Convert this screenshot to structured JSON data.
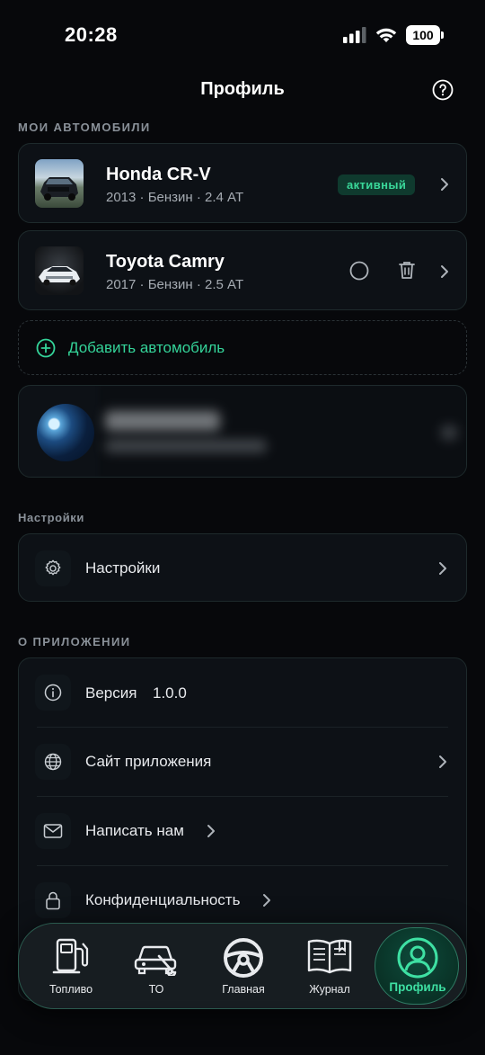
{
  "status_bar": {
    "time": "20:28",
    "battery": "100"
  },
  "header": {
    "title": "Профиль"
  },
  "cars_section": {
    "label": "МОИ АВТОМОБИЛИ",
    "cars": [
      {
        "name": "Honda CR-V",
        "details": "2013 · Бензин · 2.4 AT",
        "badge": "активный"
      },
      {
        "name": "Toyota Camry",
        "details": "2017 · Бензин · 2.5 AT"
      }
    ],
    "add_label": "Добавить автомобиль"
  },
  "settings_section": {
    "label": "Настройки",
    "item_label": "Настройки"
  },
  "about_section": {
    "label": "О ПРИЛОЖЕНИИ",
    "version_label": "Версия",
    "version_value": "1.0.0",
    "website_label": "Сайт приложения",
    "contact_label": "Написать нам",
    "privacy_label": "Конфиденциальность"
  },
  "tabbar": {
    "tabs": [
      {
        "label": "Топливо"
      },
      {
        "label": "ТО"
      },
      {
        "label": "Главная"
      },
      {
        "label": "Журнал"
      },
      {
        "label": "Профиль",
        "active": true
      }
    ]
  },
  "colors": {
    "accent": "#34d399",
    "background": "#07080b",
    "card": "#0d1116"
  }
}
